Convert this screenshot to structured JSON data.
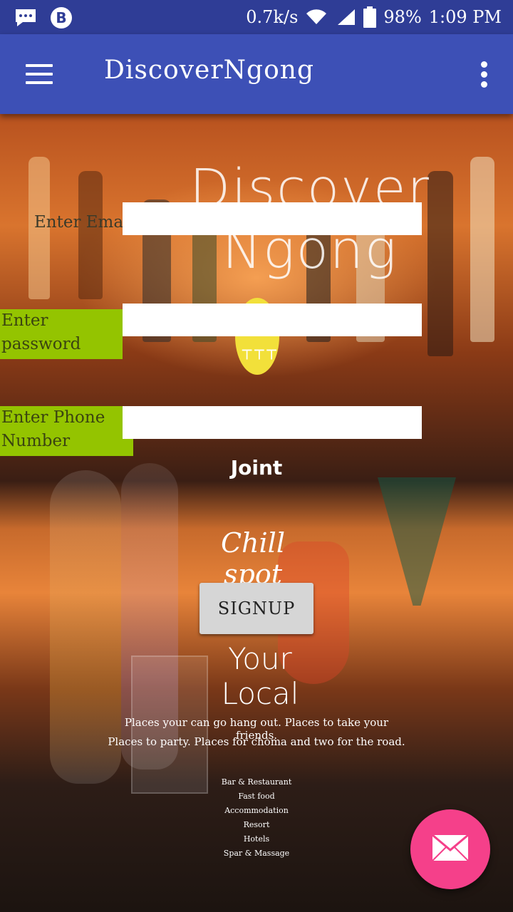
{
  "status_bar": {
    "network_speed": "0.7k/s",
    "battery": "98%",
    "time": "1:09 PM",
    "icons": [
      "messages-icon",
      "b-app-icon",
      "wifi-icon",
      "signal-icon",
      "battery-icon"
    ]
  },
  "app_bar": {
    "title": "DiscoverNgong",
    "menu_icon": "hamburger-menu-icon",
    "overflow_icon": "more-vert-icon",
    "color": "#3d50b6"
  },
  "poster": {
    "brand": "Discover Ngong",
    "joint": "Joint",
    "chill": "Chill spot",
    "your_local": "Your Local",
    "tagline_1": "Places your can go hang out. Places to take your friends.",
    "tagline_2": "Places to party. Places for choma and two for the road.",
    "services": [
      "Bar & Restaurant",
      "Fast food",
      "Accommodation",
      "Resort",
      "Hotels",
      "Spar & Massage"
    ]
  },
  "form": {
    "email_label": "Enter Ema",
    "email_value": "",
    "password_label_line1": "Enter",
    "password_label_line2": "password",
    "password_value": "",
    "phone_label_line1": "Enter Phone",
    "phone_label_line2": "Number",
    "phone_value": "",
    "label_highlight_color": "#94c400"
  },
  "signup_button": {
    "label": "SIGNUP"
  },
  "fab": {
    "icon": "email-icon",
    "color": "#f5408a"
  }
}
